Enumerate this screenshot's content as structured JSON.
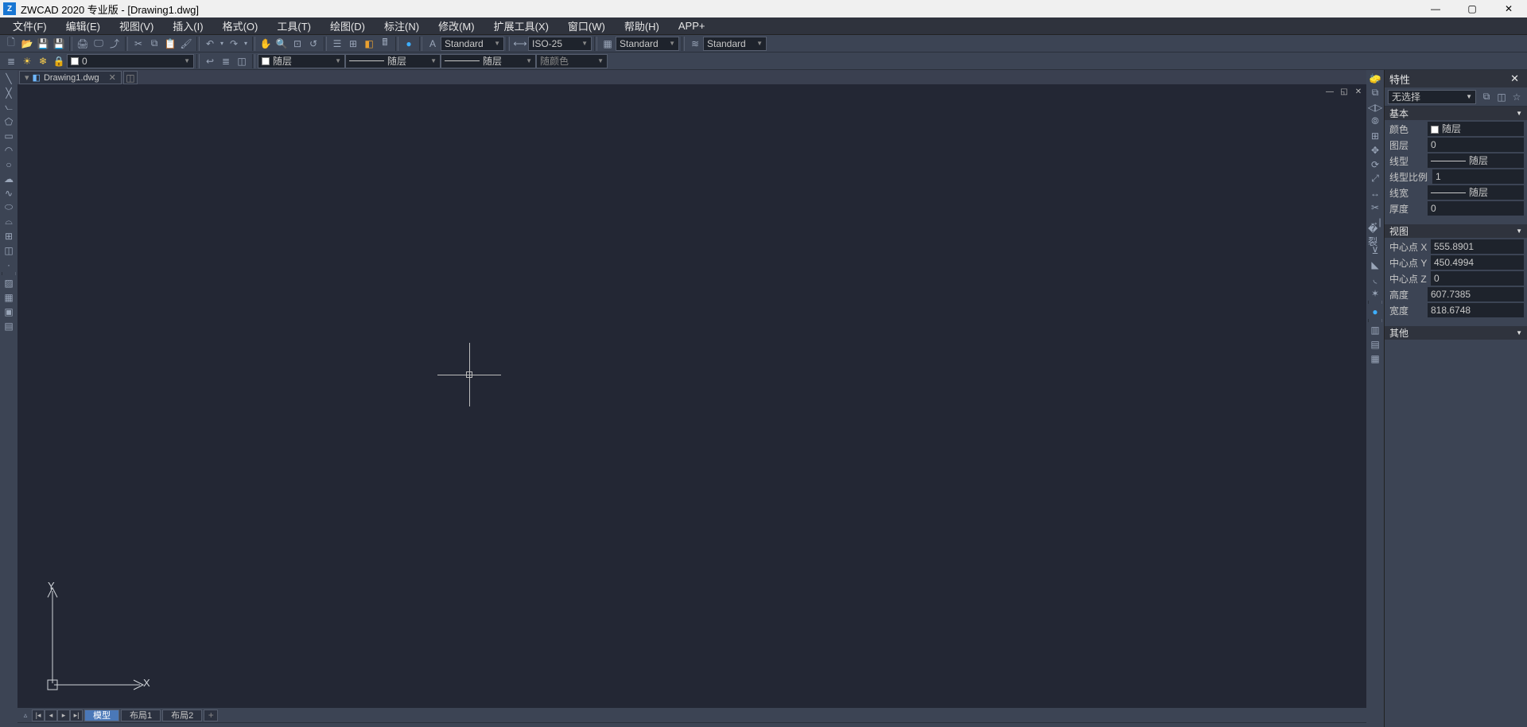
{
  "window": {
    "title": "ZWCAD 2020 专业版 - [Drawing1.dwg]"
  },
  "menu": [
    "文件(F)",
    "编辑(E)",
    "视图(V)",
    "插入(I)",
    "格式(O)",
    "工具(T)",
    "绘图(D)",
    "标注(N)",
    "修改(M)",
    "扩展工具(X)",
    "窗口(W)",
    "帮助(H)",
    "APP+"
  ],
  "style_row": {
    "text_style": "Standard",
    "dim_style": "ISO-25",
    "table_style": "Standard",
    "ml_style": "Standard"
  },
  "layer_row": {
    "current_layer": "0",
    "color": "随层",
    "linetype": "随层",
    "lineweight": "随层",
    "bycolor": "随颜色"
  },
  "file_tab": {
    "name": "Drawing1.dwg"
  },
  "bottom_tabs": {
    "active": "模型",
    "others": [
      "布局1",
      "布局2"
    ]
  },
  "properties": {
    "title": "特性",
    "selection": "无选择",
    "sections": {
      "basic": {
        "label": "基本",
        "rows": {
          "color": {
            "label": "颜色",
            "value": "随层"
          },
          "layer": {
            "label": "图层",
            "value": "0"
          },
          "linetype": {
            "label": "线型",
            "value": "随层"
          },
          "ltscale": {
            "label": "线型比例",
            "value": "1"
          },
          "lineweight": {
            "label": "线宽",
            "value": "随层"
          },
          "thickness": {
            "label": "厚度",
            "value": "0"
          }
        }
      },
      "view": {
        "label": "视图",
        "rows": {
          "cx": {
            "label": "中心点 X",
            "value": "555.8901"
          },
          "cy": {
            "label": "中心点 Y",
            "value": "450.4994"
          },
          "cz": {
            "label": "中心点 Z",
            "value": "0"
          },
          "h": {
            "label": "高度",
            "value": "607.7385"
          },
          "w": {
            "label": "宽度",
            "value": "818.6748"
          }
        }
      },
      "other": {
        "label": "其他"
      }
    }
  }
}
